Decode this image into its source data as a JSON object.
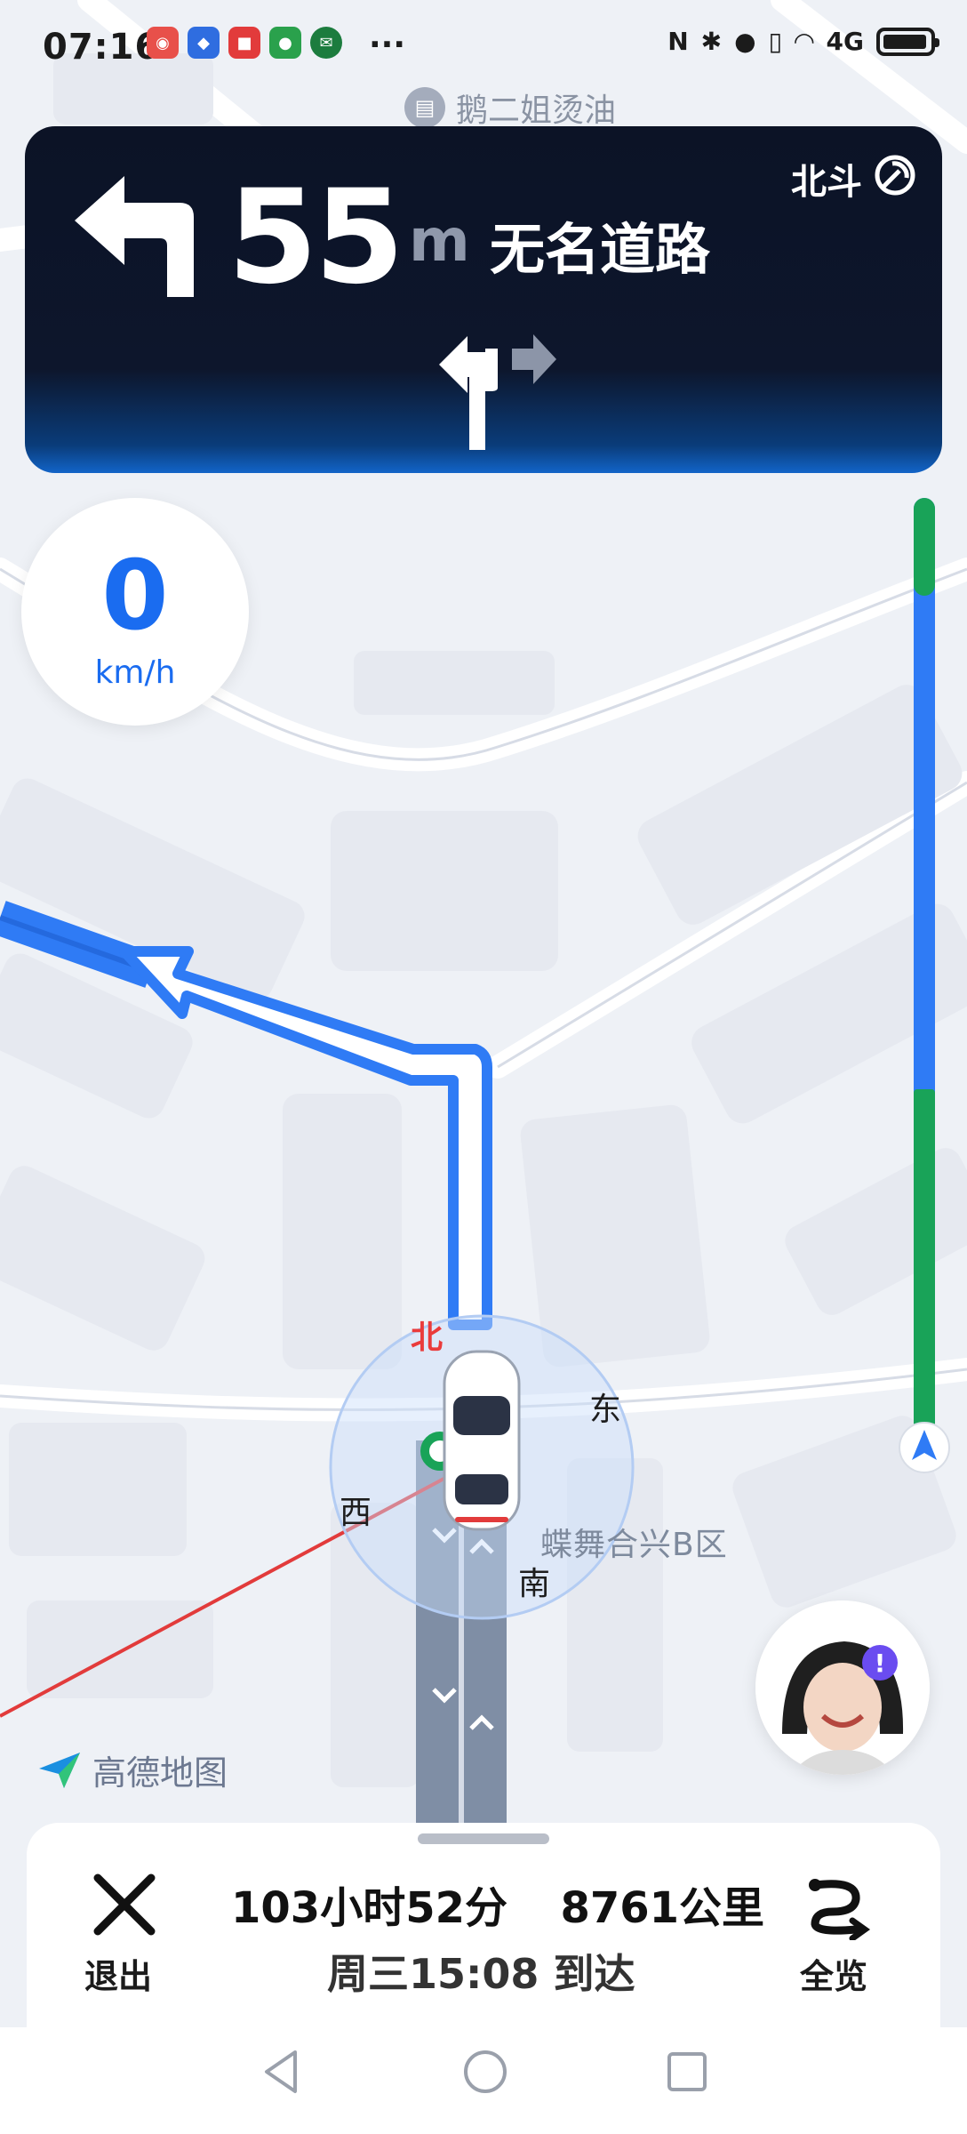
{
  "status_bar": {
    "time": "07:16",
    "more": "···",
    "network": "4G"
  },
  "map": {
    "poi_label": "鹅二姐烫油",
    "area_label": "蝶舞合兴B区",
    "compass": {
      "north": "北",
      "east": "东",
      "south": "南",
      "west": "西"
    }
  },
  "guidance": {
    "distance": "55",
    "unit": "m",
    "road": "无名道路",
    "gnss": "北斗"
  },
  "speed": {
    "value": "0",
    "unit": "km/h"
  },
  "brand": {
    "logo_text": "高德地图"
  },
  "trip": {
    "duration": "103小时52分",
    "distance": "8761公里",
    "arrival": "周三15:08 到达"
  },
  "actions": {
    "exit": "退出",
    "overview": "全览"
  },
  "colors": {
    "route": "#2f7bf5",
    "traffic_green": "#19a358",
    "north": "#ea3b3b",
    "card": "#0c1326"
  }
}
